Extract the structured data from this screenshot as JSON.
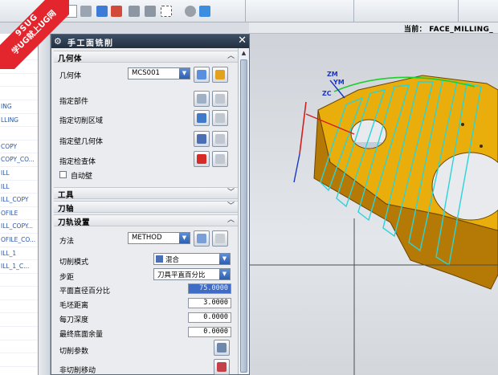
{
  "watermark": {
    "top": "9SUG",
    "bottom": "学UG就上UG网"
  },
  "status": {
    "label": "当前： FACE_MILLING_"
  },
  "nav_items": [
    "",
    "",
    "",
    "",
    "",
    "ING",
    "LLING",
    "",
    "COPY",
    "COPY_CO...",
    "ILL",
    "ILL",
    "ILL_COPY",
    "OFILE",
    "ILL_COPY...",
    "OFILE_CO...",
    "ILL_1",
    "ILL_1_C...",
    "",
    "",
    "",
    "",
    "",
    "",
    ""
  ],
  "dialog": {
    "title": "手工面铣削",
    "sections": {
      "geometry": "几何体",
      "tool": "工具",
      "axis": "刀轴",
      "path": "刀轨设置"
    },
    "geometry": {
      "label": "几何体",
      "value": "MCS001",
      "specify_part": "指定部件",
      "specify_cut_area": "指定切削区域",
      "specify_wall": "指定壁几何体",
      "specify_check": "指定检查体",
      "auto_wall": "自动壁"
    },
    "path": {
      "method_label": "方法",
      "method_value": "METHOD",
      "cut_pattern_label": "切削模式",
      "cut_pattern_value": "混合",
      "stepover_label": "步距",
      "stepover_value": "刀具平直百分比",
      "flat_pct_label": "平面直径百分比",
      "flat_pct_value": "75.0000",
      "blank_dist_label": "毛坯距离",
      "blank_dist_value": "3.0000",
      "depth_label": "每刀深度",
      "depth_value": "0.0000",
      "floor_stock_label": "最终底面余量",
      "floor_stock_value": "0.0000",
      "cut_params_label": "切削参数",
      "non_cut_label": "非切削移动"
    }
  },
  "viewport": {
    "axis_zm": "ZM",
    "axis_ym": "YM",
    "axis_zc": "ZC"
  },
  "colors": {
    "part": "#e9ad0c",
    "part_side": "#b57a05",
    "toolpath": "#2ad4d9",
    "accent": "#e3262d"
  }
}
